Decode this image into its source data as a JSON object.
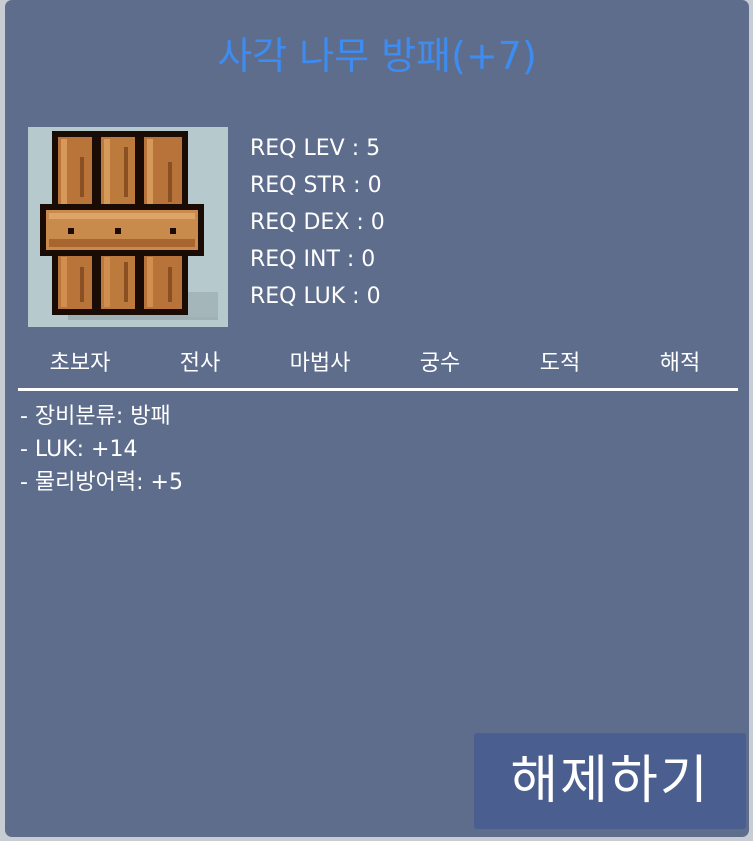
{
  "item": {
    "title": "사각 나무 방패(+7)",
    "icon": "wooden-shield-icon"
  },
  "requirements": [
    "REQ LEV : 5",
    "REQ STR : 0",
    "REQ DEX : 0",
    "REQ INT : 0",
    "REQ LUK : 0"
  ],
  "jobs": [
    "초보자",
    "전사",
    "마법사",
    "궁수",
    "도적",
    "해적"
  ],
  "stats": [
    "- 장비분류: 방패",
    "- LUK: +14",
    "- 물리방어력: +5"
  ],
  "actions": {
    "unequip_label": "해제하기"
  },
  "colors": {
    "panel": "#5f6d8d",
    "title": "#3d8cf2",
    "button": "#4a5f8f"
  }
}
